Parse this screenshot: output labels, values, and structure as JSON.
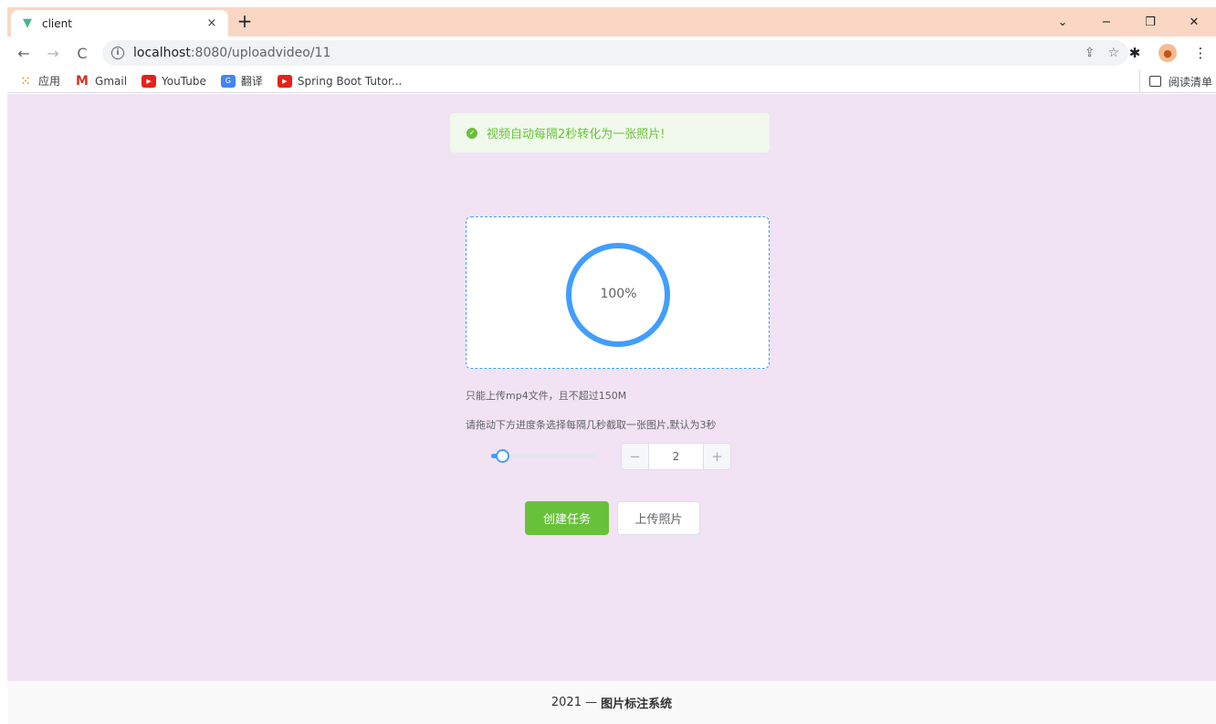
{
  "browser": {
    "tab_title": "client",
    "tab_close": "×",
    "new_tab": "+",
    "win_minimize": "−",
    "win_restore": "❐",
    "win_close": "✕",
    "tab_search": "⌄",
    "url_host": "localhost",
    "url_path": ":8080/uploadvideo/11",
    "bookmarks": [
      {
        "label": "应用",
        "icon": "apps-grid-icon"
      },
      {
        "label": "Gmail",
        "icon": "gmail-icon"
      },
      {
        "label": "YouTube",
        "icon": "youtube-icon"
      },
      {
        "label": "翻译",
        "icon": "translate-icon"
      },
      {
        "label": "Spring Boot Tutor...",
        "icon": "youtube-icon"
      }
    ],
    "reading_list": "阅读清单"
  },
  "alert": {
    "text": "视频自动每隔2秒转化为一张照片!",
    "color": "#67c23a"
  },
  "upload": {
    "progress_label": "100%",
    "progress": 100,
    "progress_color": "#409eff",
    "tip_file": "只能上传mp4文件，且不超过150M",
    "tip_interval": "请拖动下方进度条选择每隔几秒截取一张图片,默认为3秒"
  },
  "interval": {
    "value": "2",
    "slider_fraction": 0.1,
    "minus": "−",
    "plus": "+"
  },
  "buttons": {
    "create_task": "创建任务",
    "upload_photo": "上传照片"
  },
  "footer": {
    "year": "2021 —",
    "brand": "图片标注系统"
  },
  "colors": {
    "page_bg": "#f2e3f4",
    "tab_strip": "#f9d7c4",
    "primary": "#67c23a",
    "accent": "#409eff"
  }
}
